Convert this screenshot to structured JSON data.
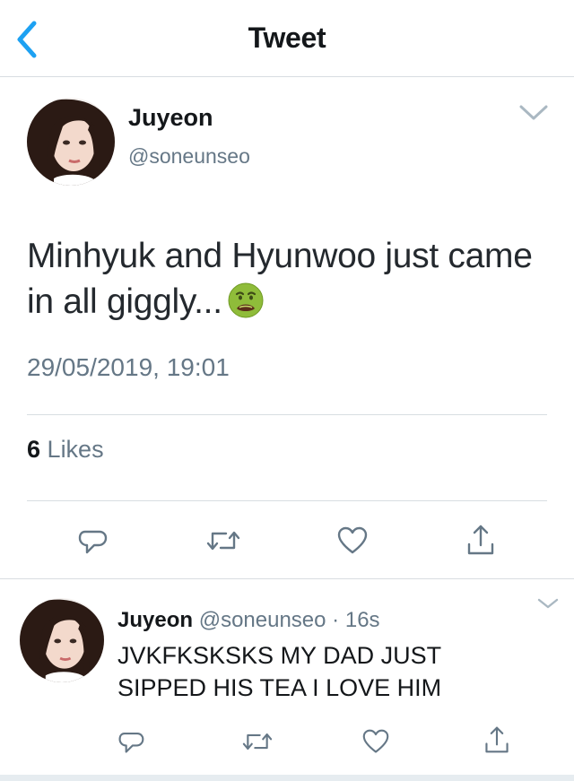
{
  "header": {
    "title": "Tweet",
    "back_icon": "chevron-left-icon"
  },
  "main_tweet": {
    "author_name": "Juyeon",
    "author_handle": "@soneunseo",
    "text": "Minhyuk and Hyunwoo just came in all giggly...",
    "emoji": "nauseated-face-emoji",
    "timestamp": "29/05/2019, 19:01",
    "likes_count": "6",
    "likes_label": "Likes",
    "actions": [
      "reply-icon",
      "retweet-icon",
      "like-icon",
      "share-icon"
    ]
  },
  "reply_tweet": {
    "author_name": "Juyeon",
    "author_handle": "@soneunseo",
    "separator": "·",
    "time": "16s",
    "text": "JVKFKSKSKS MY DAD JUST SIPPED HIS TEA I LOVE HIM",
    "actions": [
      "reply-icon",
      "retweet-icon",
      "like-icon",
      "share-icon"
    ]
  },
  "colors": {
    "accent": "#1da1f2",
    "text_secondary": "#657786",
    "border": "#d8dde1",
    "icon": "#657786"
  }
}
